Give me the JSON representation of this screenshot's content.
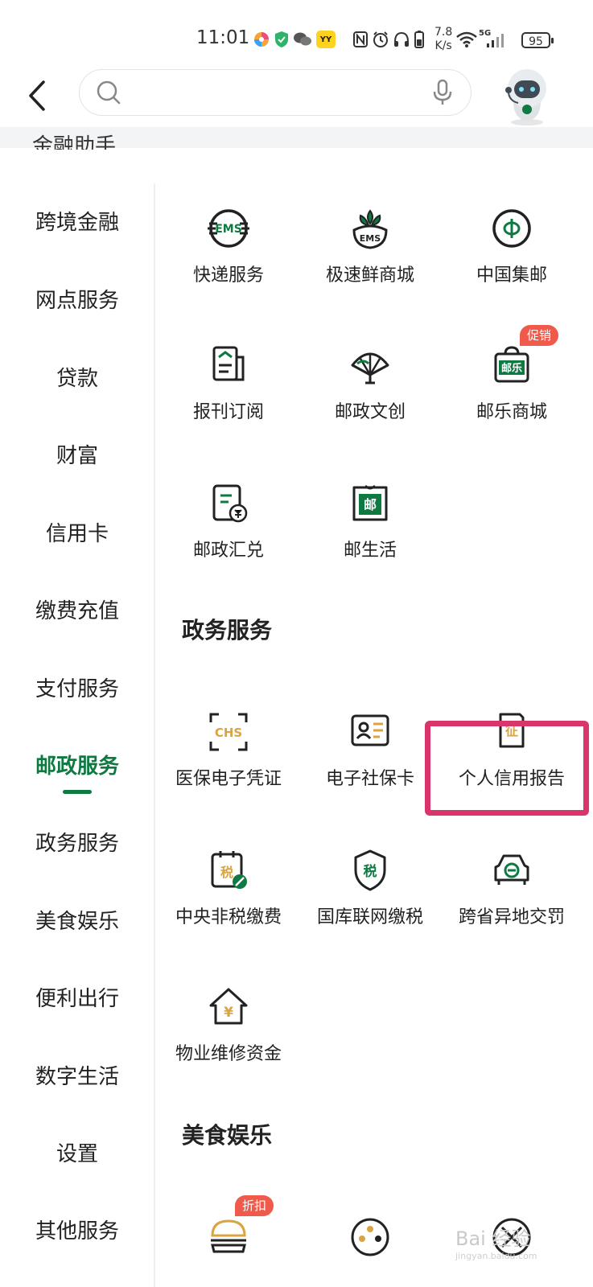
{
  "status_bar": {
    "time": "11:01",
    "net_speed_value": "7.8",
    "net_speed_unit": "K/s",
    "network_type": "5G",
    "battery": "95"
  },
  "header": {
    "search_placeholder": ""
  },
  "clipped_category": "金融助手",
  "sidebar": {
    "items": [
      {
        "label": "跨境金融"
      },
      {
        "label": "网点服务"
      },
      {
        "label": "贷款"
      },
      {
        "label": "财富"
      },
      {
        "label": "信用卡"
      },
      {
        "label": "缴费充值"
      },
      {
        "label": "支付服务"
      },
      {
        "label": "邮政服务",
        "active": true
      },
      {
        "label": "政务服务"
      },
      {
        "label": "美食娱乐"
      },
      {
        "label": "便利出行"
      },
      {
        "label": "数字生活"
      },
      {
        "label": "设置"
      },
      {
        "label": "其他服务"
      }
    ]
  },
  "postal_services": [
    {
      "label": "快递服务",
      "icon": "ems-icon"
    },
    {
      "label": "极速鲜商城",
      "icon": "ems-fresh-icon"
    },
    {
      "label": "中国集邮",
      "icon": "stamp-collection-icon"
    },
    {
      "label": "报刊订阅",
      "icon": "newspaper-icon"
    },
    {
      "label": "邮政文创",
      "icon": "fan-icon"
    },
    {
      "label": "邮乐商城",
      "icon": "shopping-bag-icon",
      "badge": "促销"
    },
    {
      "label": "邮政汇兑",
      "icon": "remittance-icon"
    },
    {
      "label": "邮生活",
      "icon": "post-life-icon"
    }
  ],
  "government_section": {
    "title": "政务服务",
    "items": [
      {
        "label": "医保电子凭证",
        "icon": "chs-icon"
      },
      {
        "label": "电子社保卡",
        "icon": "id-card-icon"
      },
      {
        "label": "个人信用报告",
        "icon": "credit-report-icon"
      },
      {
        "label": "中央非税缴费",
        "icon": "non-tax-icon"
      },
      {
        "label": "国库联网缴税",
        "icon": "tax-shield-icon"
      },
      {
        "label": "跨省异地交罚",
        "icon": "traffic-fine-icon"
      },
      {
        "label": "物业维修资金",
        "icon": "house-yuan-icon"
      }
    ]
  },
  "food_section": {
    "title": "美食娱乐",
    "items": [
      {
        "icon": "burger-icon",
        "badge": "折扣"
      },
      {
        "icon": "film-reel-icon"
      },
      {
        "icon": "cross-circle-icon"
      }
    ]
  },
  "watermark": {
    "text": "Bai 经验",
    "sub": "jingyan.baidu.com"
  },
  "colors": {
    "accent_green": "#0e7a42",
    "highlight": "#d9356b",
    "badge_red": "#ef5a4a",
    "icon_gold": "#d9a441"
  }
}
